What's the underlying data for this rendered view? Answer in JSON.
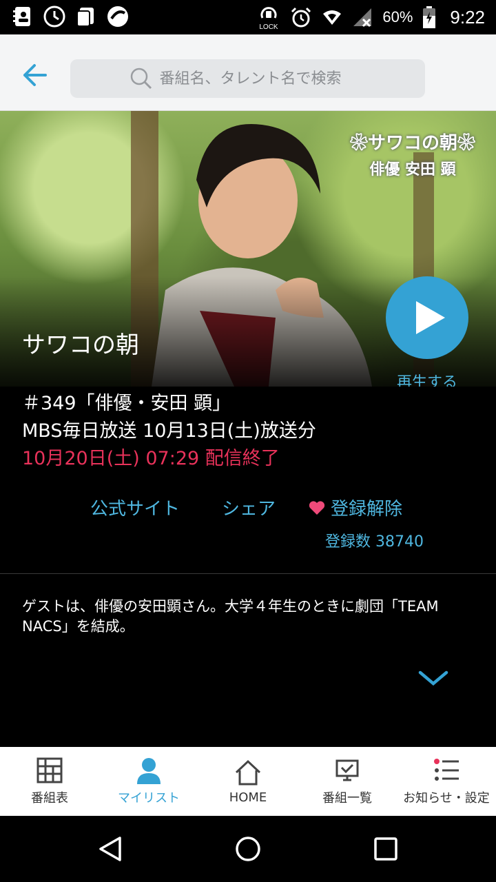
{
  "status_bar": {
    "battery": "60%",
    "time": "9:22",
    "lock_label": "LOCK"
  },
  "header": {
    "search_placeholder": "番組名、タレント名で検索"
  },
  "hero": {
    "overlay_title": "❀サワコの朝❀",
    "overlay_subtitle": "俳優 安田 顕",
    "program_title": "サワコの朝",
    "play_label": "再生する"
  },
  "info": {
    "episode": "＃349「俳優・安田 顕」",
    "broadcast": "MBS毎日放送 10月13日(土)放送分",
    "expiry": "10月20日(土) 07:29 配信終了"
  },
  "actions": {
    "official": "公式サイト",
    "share": "シェア",
    "favorite": "登録解除",
    "reg_count": "登録数 38740"
  },
  "description": "ゲストは、俳優の安田顕さん。大学４年生のときに劇団「TEAM NACS」を結成。",
  "bottom_nav": [
    {
      "label": "番組表",
      "icon": "grid-icon",
      "active": false
    },
    {
      "label": "マイリスト",
      "icon": "person-icon",
      "active": true
    },
    {
      "label": "HOME",
      "icon": "home-icon",
      "active": false
    },
    {
      "label": "番組一覧",
      "icon": "tv-list-icon",
      "active": false
    },
    {
      "label": "お知らせ・設定",
      "icon": "list-icon",
      "active": false
    }
  ],
  "colors": {
    "accent": "#34a2d4",
    "link": "#4fb7e0",
    "expiry": "#e8325a",
    "heart": "#ef4a7a"
  }
}
